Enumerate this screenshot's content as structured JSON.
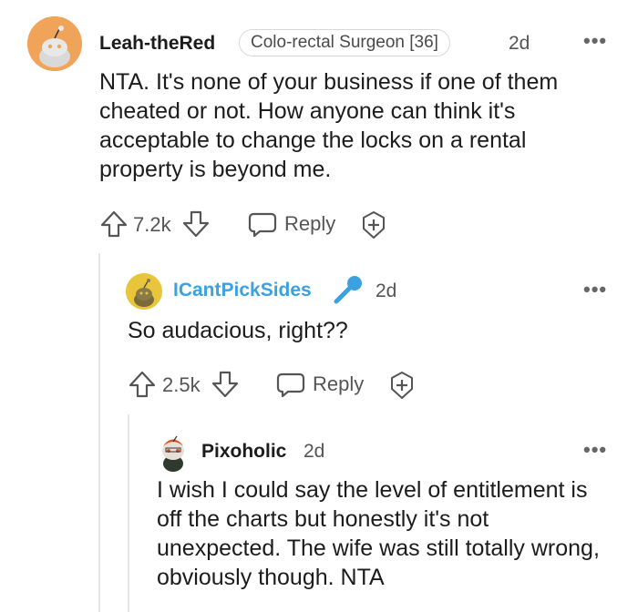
{
  "comments": [
    {
      "username": "Leah-theRed",
      "flair": "Colo-rectal Surgeon [36]",
      "time": "2d",
      "more": "•••",
      "body": "NTA. It's none of your business if one of them cheated or not. How anyone can think it's acceptable to change the locks on a rental property is beyond me.",
      "votes": "7.2k",
      "reply_label": "Reply"
    },
    {
      "username": "ICantPickSides",
      "time": "2d",
      "more": "•••",
      "body": "So audacious, right??",
      "votes": "2.5k",
      "reply_label": "Reply"
    },
    {
      "username": "Pixoholic",
      "time": "2d",
      "more": "•••",
      "body": "I wish I could say the level of entitlement is off the charts but honestly it's not unexpected. The wife was still totally wrong, obviously though. NTA"
    }
  ],
  "icons": {
    "upvote": "arrow-up-icon",
    "downvote": "arrow-down-icon",
    "reply": "speech-bubble-icon",
    "award": "plus-award-icon",
    "microphone": "microphone-icon"
  },
  "colors": {
    "accent_blue": "#3ba1e0",
    "avatar_orange": "#f0a45a",
    "avatar_yellow": "#e8c53a"
  }
}
